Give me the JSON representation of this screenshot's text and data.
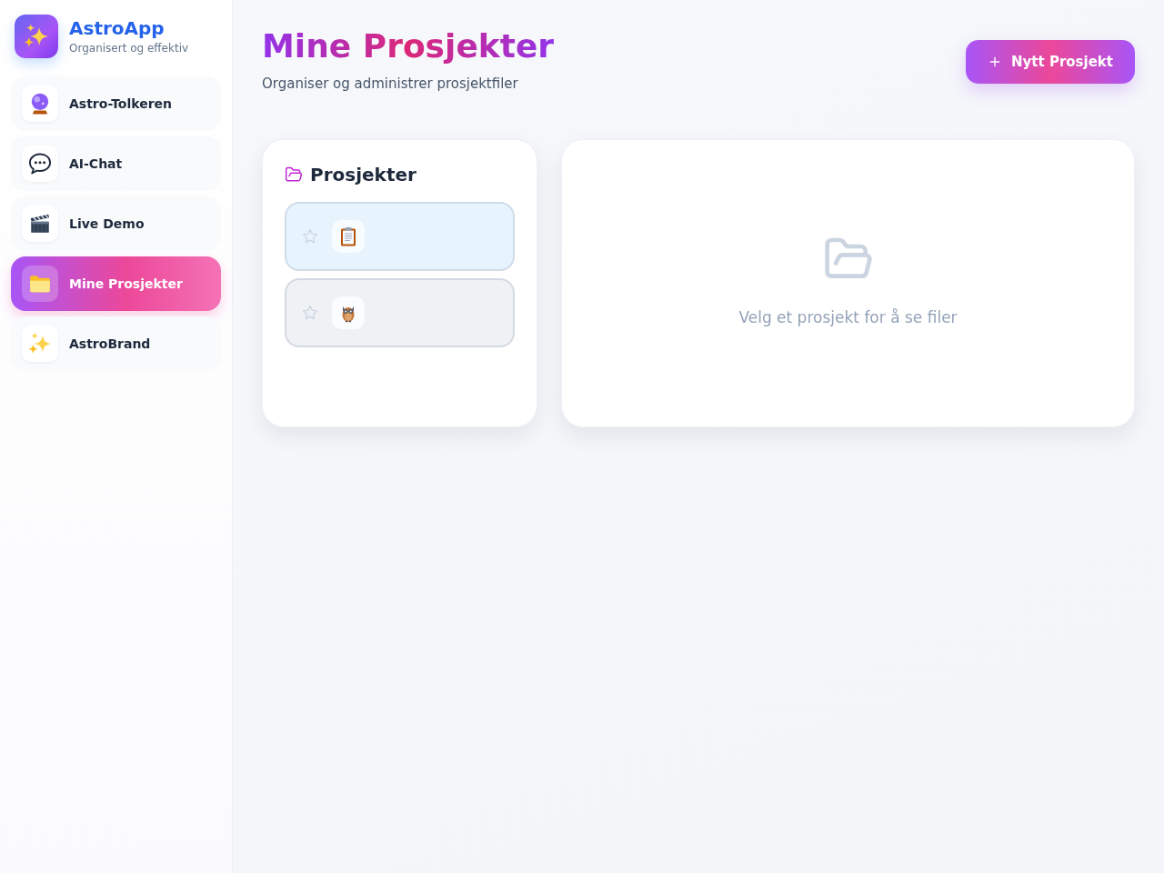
{
  "sidebar": {
    "brand": {
      "title": "AstroApp",
      "subtitle": "Organisert og effektiv"
    },
    "items": [
      {
        "label": "Astro-Tolkeren",
        "kind": "orb",
        "selected": false
      },
      {
        "label": "AI-Chat",
        "kind": "chat",
        "selected": false
      },
      {
        "label": "Live Demo",
        "kind": "clapper",
        "selected": false
      },
      {
        "label": "Mine Prosjekter",
        "kind": "folder",
        "selected": true
      },
      {
        "label": "AstroBrand",
        "kind": "sparkles",
        "selected": false
      }
    ]
  },
  "header": {
    "title": "Mine Prosjekter",
    "subtitle": "Organiser og administrer prosjektfiler",
    "new_button": {
      "label": "Nytt Prosjekt"
    }
  },
  "projects_panel": {
    "title": "Prosjekter",
    "projects": [
      {
        "kind": "clipboard",
        "starred": false,
        "color": "#e8f4fd"
      },
      {
        "kind": "owl",
        "starred": false,
        "color": "#eff1f5"
      }
    ]
  },
  "files_panel": {
    "empty_message": "Velg et prosjekt for å se filer"
  }
}
